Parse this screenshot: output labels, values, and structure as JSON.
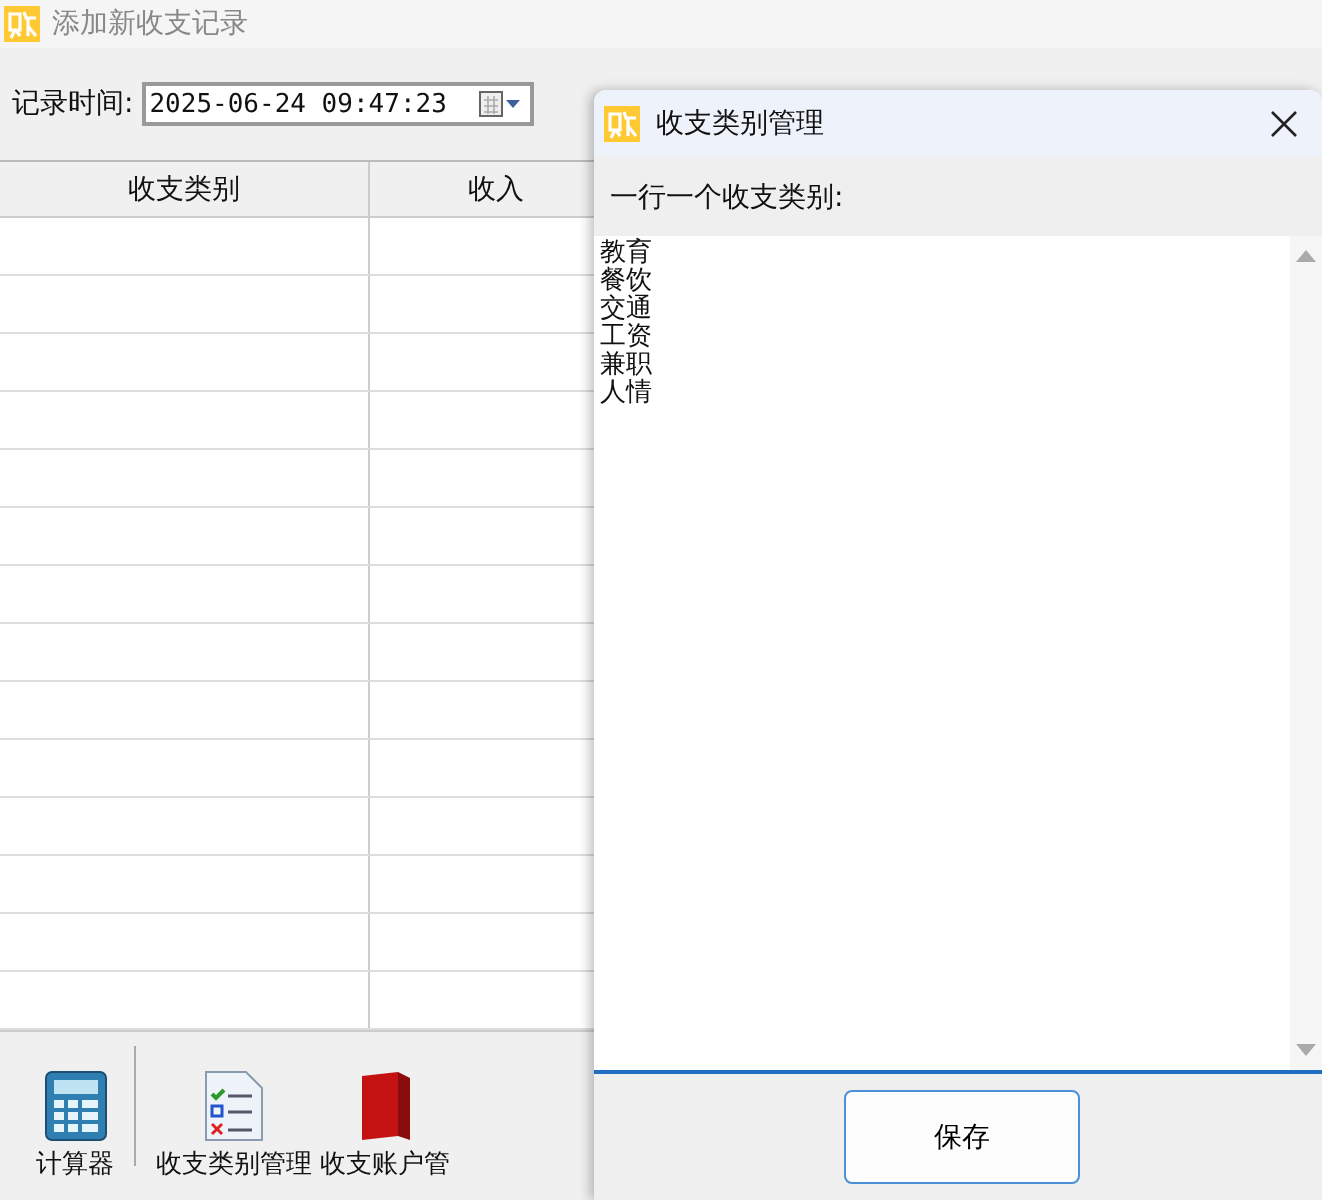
{
  "window": {
    "title": "添加新收支记录"
  },
  "record_time": {
    "label": "记录时间:",
    "value": "2025-06-24 09:47:23"
  },
  "table": {
    "columns": [
      "收支类别",
      "收入"
    ]
  },
  "toolbar": [
    {
      "label": "计算器",
      "kind": "calculator"
    },
    {
      "label": "收支类别管理",
      "kind": "checklist"
    },
    {
      "label": "收支账户管",
      "kind": "book"
    }
  ],
  "dialog": {
    "title": "收支类别管理",
    "prompt": "一行一个收支类别:",
    "lines": [
      "教育",
      "餐饮",
      "交通",
      "工资",
      "兼职",
      "人情"
    ],
    "button": "保存"
  }
}
